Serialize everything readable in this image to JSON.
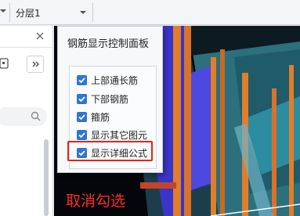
{
  "toolbar": {
    "floor_value": "分层1"
  },
  "control_panel": {
    "title": "钢筋显示控制面板",
    "items": [
      {
        "label": "上部通长筋",
        "checked": true
      },
      {
        "label": "下部钢筋",
        "checked": true
      },
      {
        "label": "箍筋",
        "checked": true
      },
      {
        "label": "显示其它图元",
        "checked": true
      },
      {
        "label": "显示详细公式",
        "checked": true
      }
    ]
  },
  "annotation": {
    "text": "取消勾选",
    "color": "#ff2a2a"
  },
  "colors": {
    "checkbox": "#2f76d2",
    "highlight": "#e2231a",
    "rebar_orange": "#e27d2a",
    "rebar_blue": "#3a35c8",
    "concrete_teal": "#2c6f7d"
  }
}
